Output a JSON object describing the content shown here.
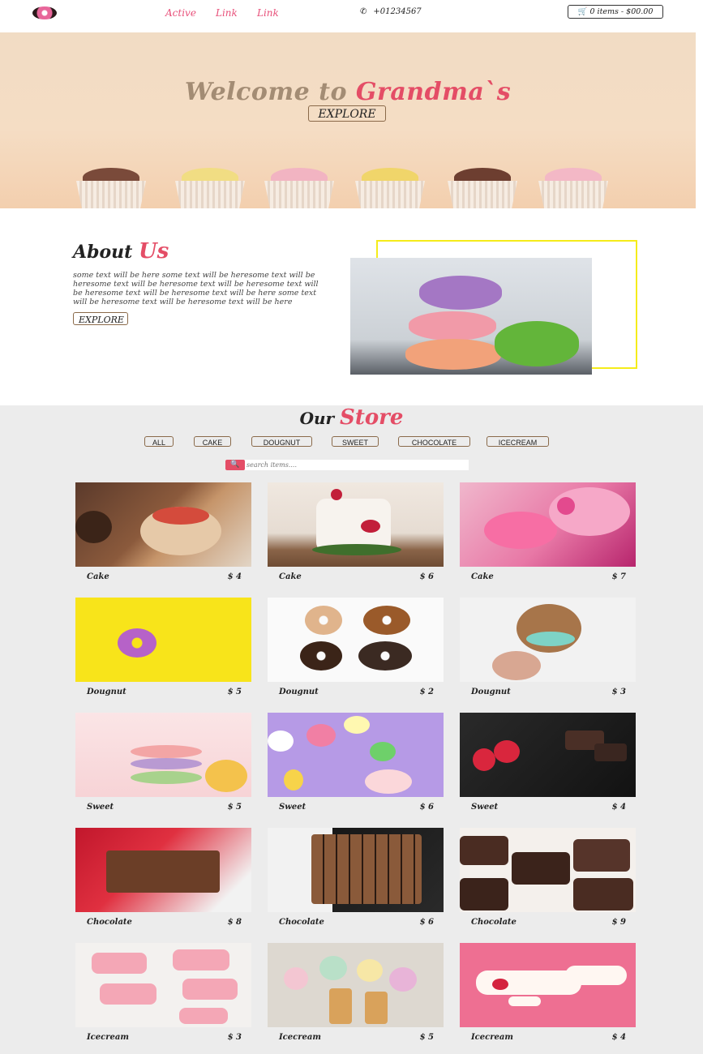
{
  "nav": {
    "links": [
      "Active",
      "Link",
      "Link"
    ],
    "phone": "+01234567",
    "cart_label": "0 items - $00.00"
  },
  "hero": {
    "title_prefix": "Welcome to ",
    "title_accent": "Grandma`s",
    "button": "EXPLORE"
  },
  "about": {
    "title_prefix": "About ",
    "title_accent": "Us",
    "text": "some text will be here some text will be heresome text will be heresome text will be heresome text will be heresome text will be heresome text will be heresome text will be here some text will be heresome text will be heresome text will be here",
    "button": "EXPLORE"
  },
  "store": {
    "title_prefix": "Our ",
    "title_accent": "Store",
    "filters": [
      "ALL",
      "CAKE",
      "DOUGNUT",
      "SWEET",
      "CHOCOLATE",
      "ICECREAM"
    ],
    "search_placeholder": "search items....",
    "items": [
      {
        "name": "Cake",
        "price": "$ 4"
      },
      {
        "name": "Cake",
        "price": "$ 6"
      },
      {
        "name": "Cake",
        "price": "$ 7"
      },
      {
        "name": "Dougnut",
        "price": "$ 5"
      },
      {
        "name": "Dougnut",
        "price": "$ 2"
      },
      {
        "name": "Dougnut",
        "price": "$ 3"
      },
      {
        "name": "Sweet",
        "price": "$ 5"
      },
      {
        "name": "Sweet",
        "price": "$ 6"
      },
      {
        "name": "Sweet",
        "price": "$ 4"
      },
      {
        "name": "Chocolate",
        "price": "$ 8"
      },
      {
        "name": "Chocolate",
        "price": "$ 6"
      },
      {
        "name": "Chocolate",
        "price": "$ 9"
      },
      {
        "name": "Icecream",
        "price": "$ 3"
      },
      {
        "name": "Icecream",
        "price": "$ 5"
      },
      {
        "name": "Icecream",
        "price": "$ 4"
      }
    ]
  },
  "colors": {
    "accent": "#e44d66",
    "nav_link": "#e8507a",
    "store_bg": "#ececec",
    "frame": "#f5ec1a"
  },
  "icons": [
    "donut-logo-icon",
    "phone-icon",
    "cart-icon",
    "search-icon"
  ]
}
